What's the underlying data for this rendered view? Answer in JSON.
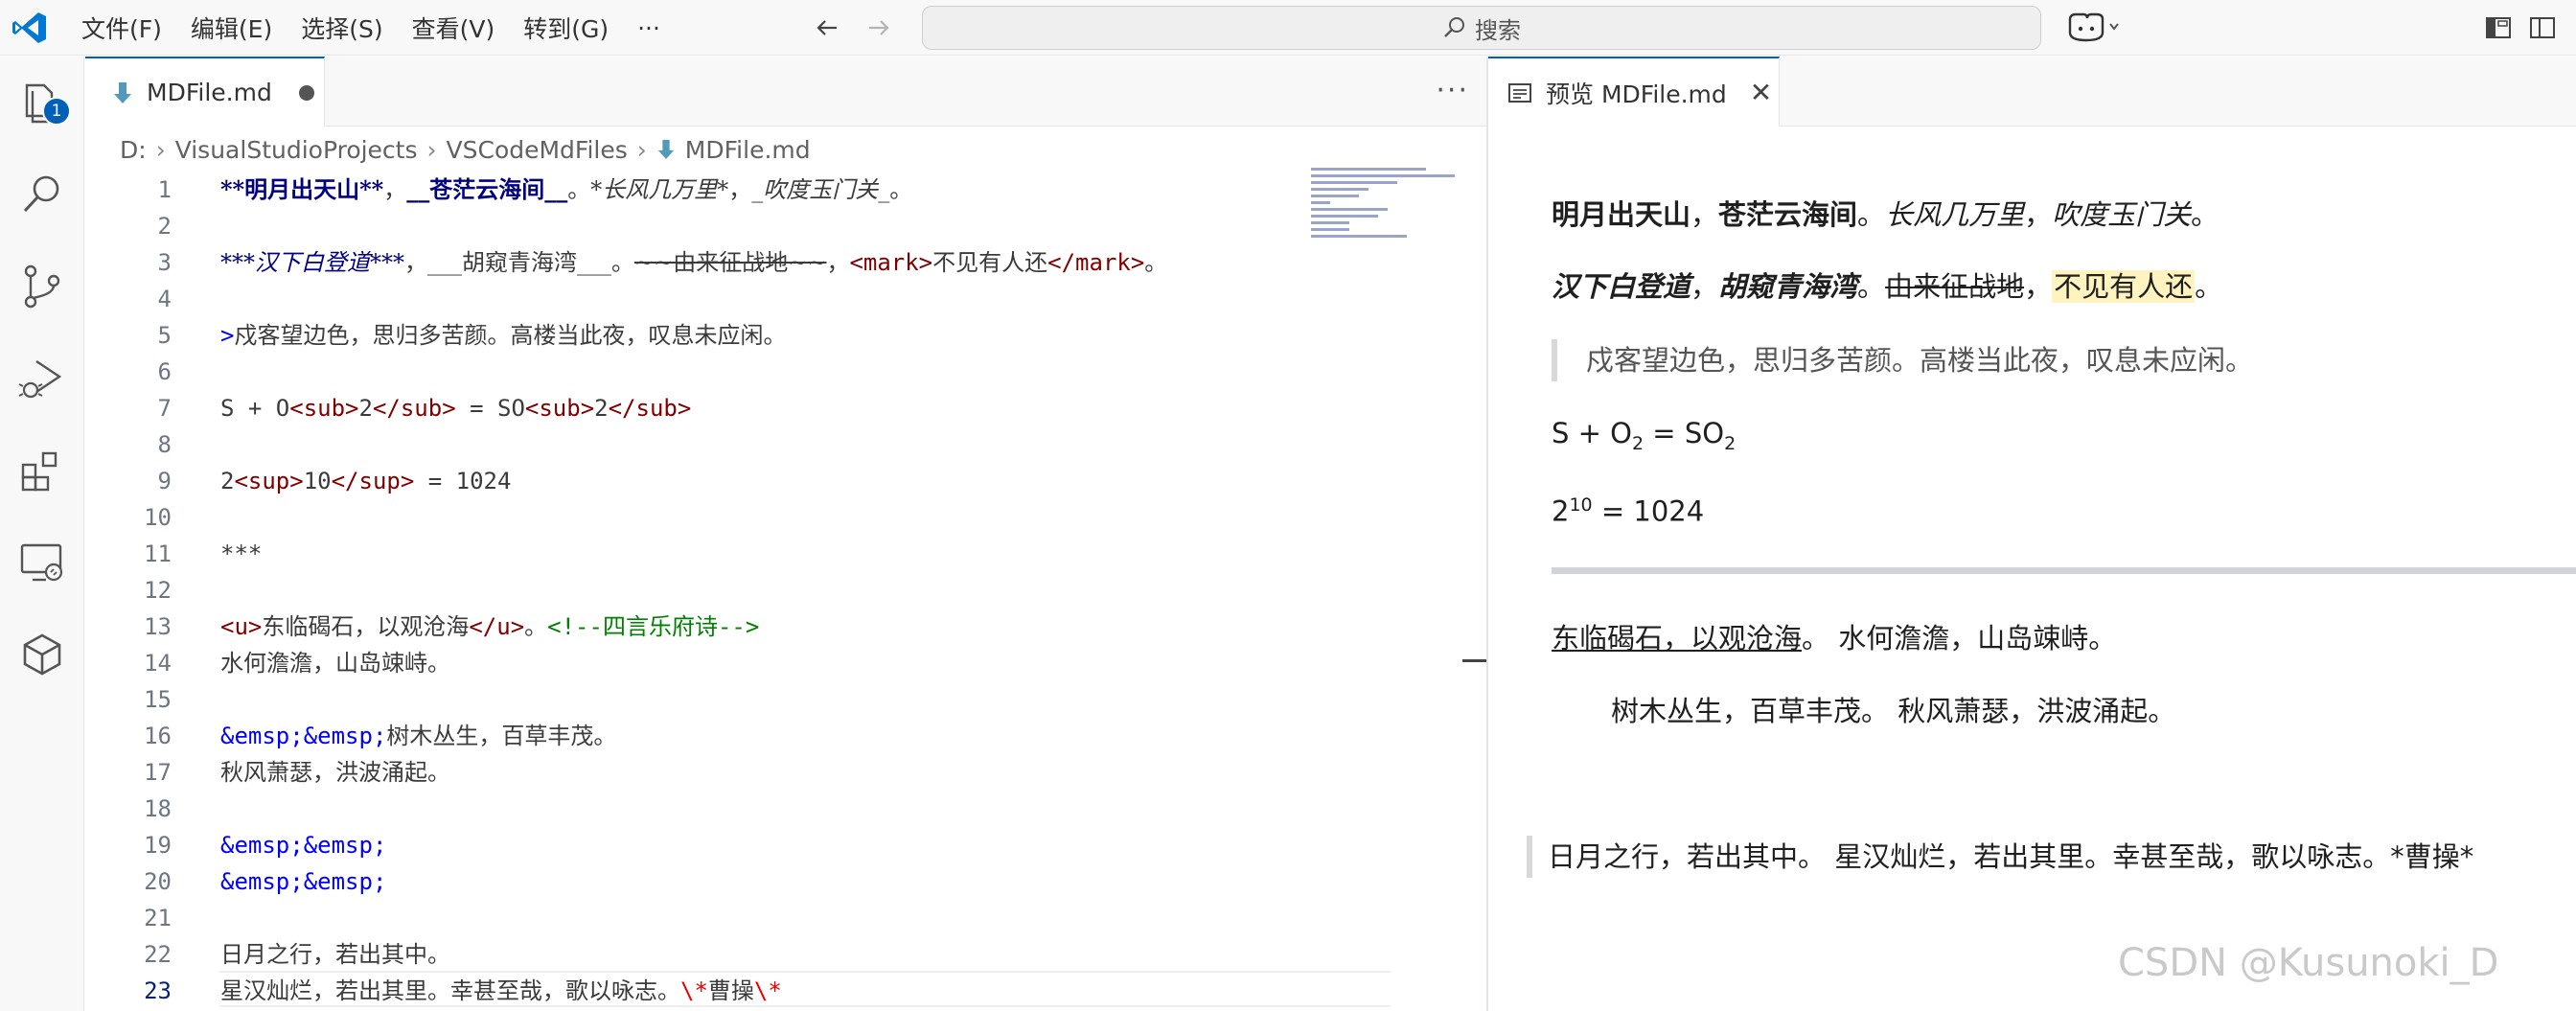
{
  "titlebar": {
    "menus": [
      "文件(F)",
      "编辑(E)",
      "选择(S)",
      "查看(V)",
      "转到(G)",
      "···"
    ],
    "search_placeholder": "搜索"
  },
  "activity": {
    "explorer_badge": "1"
  },
  "editor": {
    "tab_label": "MDFile.md",
    "more": "···",
    "breadcrumb": [
      "D:",
      "VisualStudioProjects",
      "VSCodeMdFiles",
      "MDFile.md"
    ],
    "current_line": 23,
    "line_numbers": [
      "1",
      "2",
      "3",
      "4",
      "5",
      "6",
      "7",
      "8",
      "9",
      "10",
      "11",
      "12",
      "13",
      "14",
      "15",
      "16",
      "17",
      "18",
      "19",
      "20",
      "21",
      "22",
      "23"
    ],
    "lines": {
      "l1": [
        "**明月出天山**",
        "，",
        "__苍茫云海间__",
        "。",
        "*长风几万里*",
        "，",
        "_吹度玉门关_",
        "。"
      ],
      "l3": [
        "***汉下白登道***",
        "，",
        "___胡窥青海湾___",
        "。",
        "~~由来征战地~~",
        "，",
        "<mark>",
        "不见有人还",
        "</mark>",
        "。"
      ],
      "l5": [
        ">",
        "戍客望边色，思归多苦颜。高楼当此夜，叹息未应闲。"
      ],
      "l7": [
        "S + O",
        "<sub>",
        "2",
        "</sub>",
        " = SO",
        "<sub>",
        "2",
        "</sub>"
      ],
      "l9": [
        "2",
        "<sup>",
        "10",
        "</sup>",
        " = 1024"
      ],
      "l11": "***",
      "l13": [
        "<u>",
        "东临碣石，以观沧海",
        "</u>",
        "。",
        "<!--四言乐府诗-->"
      ],
      "l14": "水何澹澹，山岛竦峙。",
      "l16": [
        "&emsp;&emsp;",
        "树木丛生，百草丰茂。"
      ],
      "l17": "秋风萧瑟，洪波涌起。",
      "l19": "&emsp;&emsp;",
      "l20": "&emsp;&emsp;",
      "l22": "日月之行，若出其中。",
      "l23": [
        "星汉灿烂，若出其里。幸甚至哉，歌以咏志。",
        "\\*",
        "曹操",
        "\\*"
      ]
    }
  },
  "preview": {
    "tab_label": "预览 MDFile.md",
    "close": "✕",
    "p1": [
      "明月出天山",
      "，",
      "苍茫云海间",
      "。",
      "长风几万里",
      "，",
      "吹度玉门关",
      "。"
    ],
    "p2": [
      "汉下白登道",
      "，",
      "胡窥青海湾",
      "。",
      "由来征战地",
      "，",
      "不见有人还",
      "。"
    ],
    "quote1": "戍客望边色，思归多苦颜。高楼当此夜，叹息未应闲。",
    "formula1": [
      "S + O",
      "2",
      " = SO",
      "2"
    ],
    "formula2": [
      "2",
      "10",
      " = 1024"
    ],
    "p3": [
      "东临碣石，以观沧海",
      "。 水何澹澹，山岛竦峙。"
    ],
    "p4": "树木丛生，百草丰茂。 秋风萧瑟，洪波涌起。",
    "quote2": "日月之行，若出其中。 星汉灿烂，若出其里。幸甚至哉，歌以咏志。*曹操*"
  },
  "watermark": "CSDN @Kusunoki_D",
  "colors": {
    "accent": "#005fb8",
    "md_bold": "#000080",
    "html_tag": "#800000",
    "comment": "#008000",
    "entity": "#0000ff",
    "escape": "#ee0000",
    "mark_bg": "#fff3c0"
  }
}
